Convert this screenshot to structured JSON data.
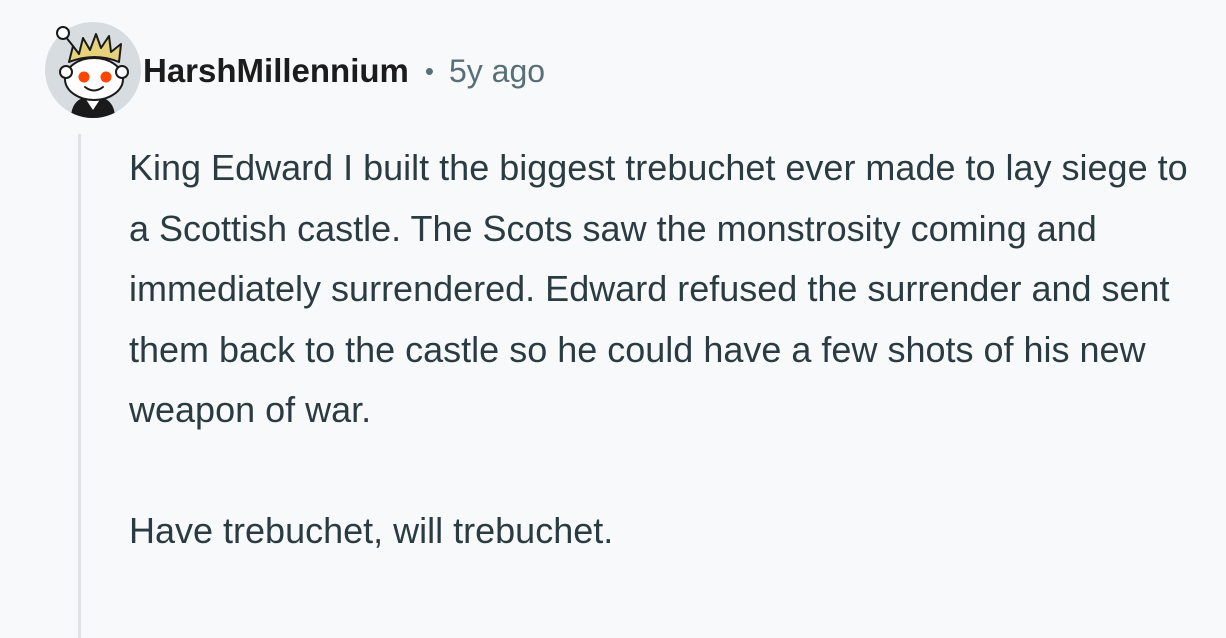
{
  "comment": {
    "author": "HarshMillennium",
    "separator": "•",
    "timestamp": "5y ago",
    "paragraphs": [
      "King Edward I built the biggest trebuchet ever made to lay siege to a Scottish castle. The Scots saw the monstrosity coming and immediately surrendered. Edward refused the surrender and sent them back to the castle so he could have a few shots of his new weapon of war.",
      "Have trebuchet, will trebuchet."
    ]
  },
  "colors": {
    "background": "#f8f9fb",
    "author_text": "#1c1c1c",
    "meta_text": "#576f76",
    "body_text": "#2a3c42",
    "thread_line": "#dfe3e8",
    "avatar_bg": "#d7dce0",
    "avatar_hair": "#e6d27a",
    "avatar_eye": "#ff4500"
  },
  "icons": {
    "avatar": "snoo-avatar-icon"
  }
}
